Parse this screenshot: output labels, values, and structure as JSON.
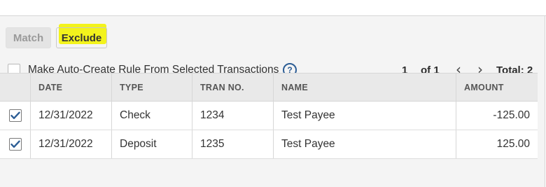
{
  "toolbar": {
    "match_label": "Match",
    "exclude_label": "Exclude"
  },
  "auto_create": {
    "label": "Make Auto-Create Rule From Selected Transactions",
    "help_icon": "question-circle-icon",
    "checked": false
  },
  "pager": {
    "current": "1",
    "of_label": "of 1",
    "prev_icon": "chevron-left-icon",
    "next_icon": "chevron-right-icon",
    "total_label": "Total: 2"
  },
  "table": {
    "headers": [
      "DATE",
      "TYPE",
      "TRAN NO.",
      "NAME",
      "AMOUNT"
    ],
    "rows": [
      {
        "checked": true,
        "date": "12/31/2022",
        "type": "Check",
        "tran_no": "1234",
        "name": "Test Payee",
        "amount": "-125.00"
      },
      {
        "checked": true,
        "date": "12/31/2022",
        "type": "Deposit",
        "tran_no": "1235",
        "name": "Test Payee",
        "amount": "125.00"
      }
    ]
  },
  "colors": {
    "highlight": "#f3f31c",
    "help_icon": "#2c5d95",
    "checkmark": "#2c5d95"
  }
}
